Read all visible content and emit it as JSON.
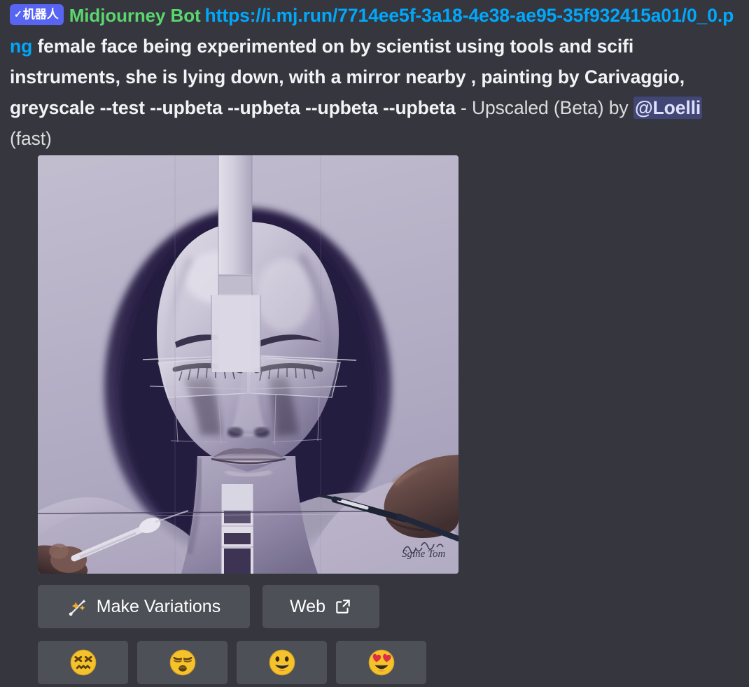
{
  "message": {
    "bot_tag": {
      "check": "✓",
      "label": "机器人"
    },
    "author": "Midjourney Bot",
    "link": "https://i.mj.run/7714ee5f-3a18-4e38-ae95-35f932415a01/0_0.png",
    "prompt": "female face being experimented on by scientist using tools and scifi instruments, she is lying down, with a mirror nearby , painting by Carivaggio, greyscale --test --upbeta --upbeta --upbeta --upbeta",
    "action_prefix": " - Upscaled (Beta) by ",
    "mention": "@Loelli",
    "speed": " (fast)"
  },
  "attachment": {
    "alt": "greyscale painting of a female face with closed eyes being worked on by hands holding instruments"
  },
  "components": {
    "buttons": [
      {
        "label": "Make Variations",
        "icon": "magic-wand-icon"
      },
      {
        "label": "Web",
        "icon": "external-link-icon"
      }
    ],
    "reactions": [
      {
        "name": "confounded-face-emoji",
        "char": "😖"
      },
      {
        "name": "persevering-face-emoji",
        "char": "😣"
      },
      {
        "name": "grinning-face-emoji",
        "char": "😃"
      },
      {
        "name": "heart-eyes-face-emoji",
        "char": "😍"
      }
    ]
  },
  "colors": {
    "background": "#36363e",
    "bot_tag": "#5865f2",
    "author": "#5ad66f",
    "link": "#00a8fc",
    "button": "#4e5058",
    "mention_bg": "#414675"
  }
}
